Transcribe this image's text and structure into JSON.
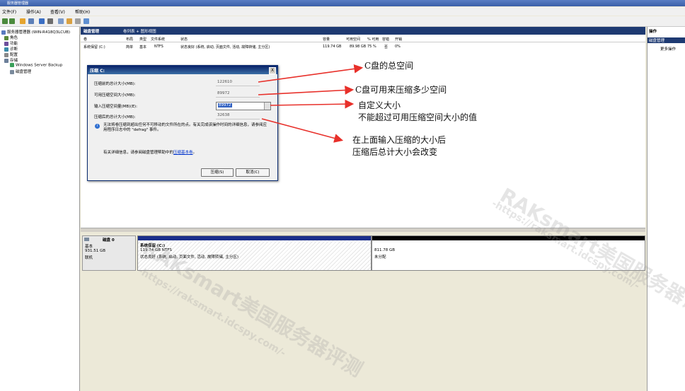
{
  "window": {
    "title": "服务器管理器"
  },
  "menu": [
    "文件(F)",
    "操作(A)",
    "查看(V)",
    "帮助(H)"
  ],
  "tree": {
    "root": "服务器管理器 (WIN-R418Q3LCUB)",
    "items": [
      "角色",
      "功能",
      "诊断",
      "配置",
      "存储",
      "Windows Server Backup",
      "磁盘管理"
    ]
  },
  "tabs": {
    "active": "磁盘管理",
    "view": "卷列表 + 图形视图"
  },
  "columns": [
    "卷",
    "布局",
    "类型",
    "文件系统",
    "状态",
    "容量",
    "可用空间",
    "% 可用",
    "容错",
    "开销"
  ],
  "volume_row": {
    "name": "系统保留 (C:)",
    "layout": "简单",
    "type": "基本",
    "fs": "NTFS",
    "status": "状态良好 (系统, 启动, 页面文件, 活动, 故障转储, 主分区)",
    "capacity": "119.74 GB",
    "free": "89.98 GB",
    "pct": "75 %",
    "fault": "否",
    "overhead": "0%"
  },
  "actions": {
    "title": "操作",
    "section": "磁盘管理",
    "more": "更多操作"
  },
  "dialog": {
    "title": "压缩 C:",
    "close": "X",
    "total_before_label": "压缩前的总计大小(MB):",
    "total_before": "122610",
    "available_label": "可用压缩空间大小(MB):",
    "available": "89972",
    "input_label": "输入压缩空间量(MB)(E):",
    "input_value": "89972",
    "total_after_label": "压缩后的总计大小(MB):",
    "total_after": "32638",
    "note": "无法将卷压缩到超出任何不可移动的文件所在的点。有关完成该操作时间的详细信息，请参阅应用程序日志中的 \"defrag\" 事件。",
    "help_text": "有关详细信息，请参阅磁盘管理帮助中的",
    "help_link": "压缩基本卷",
    "help_end": "。",
    "shrink_btn": "压缩(S)",
    "cancel_btn": "取消(C)"
  },
  "disk": {
    "name": "磁盘 0",
    "type": "基本",
    "size": "931.51 GB",
    "status": "联机",
    "part1_name": "系统保留  (C:)",
    "part1_size": "119.74 GB NTFS",
    "part1_status": "状态良好 (系统, 启动, 页面文件, 活动, 故障转储, 主分区)",
    "part2_size": "811.78 GB",
    "part2_status": "未分配"
  },
  "annotations": {
    "a1": "C盘的总空间",
    "a2": "C盘可用来压缩多少空间",
    "a3_line1": "自定义大小",
    "a3_line2": "不能超过可用压缩空间大小的值",
    "a4_line1": "在上面输入压缩的大小后",
    "a4_line2": "压缩后总计大小会改变"
  },
  "watermark": {
    "brand": "RAKsmart美国服务器评测",
    "url": "-https://raksmart.idcspy.com/-"
  },
  "colors": {
    "accent": "#1e3a72",
    "arrow": "#e8302a"
  }
}
